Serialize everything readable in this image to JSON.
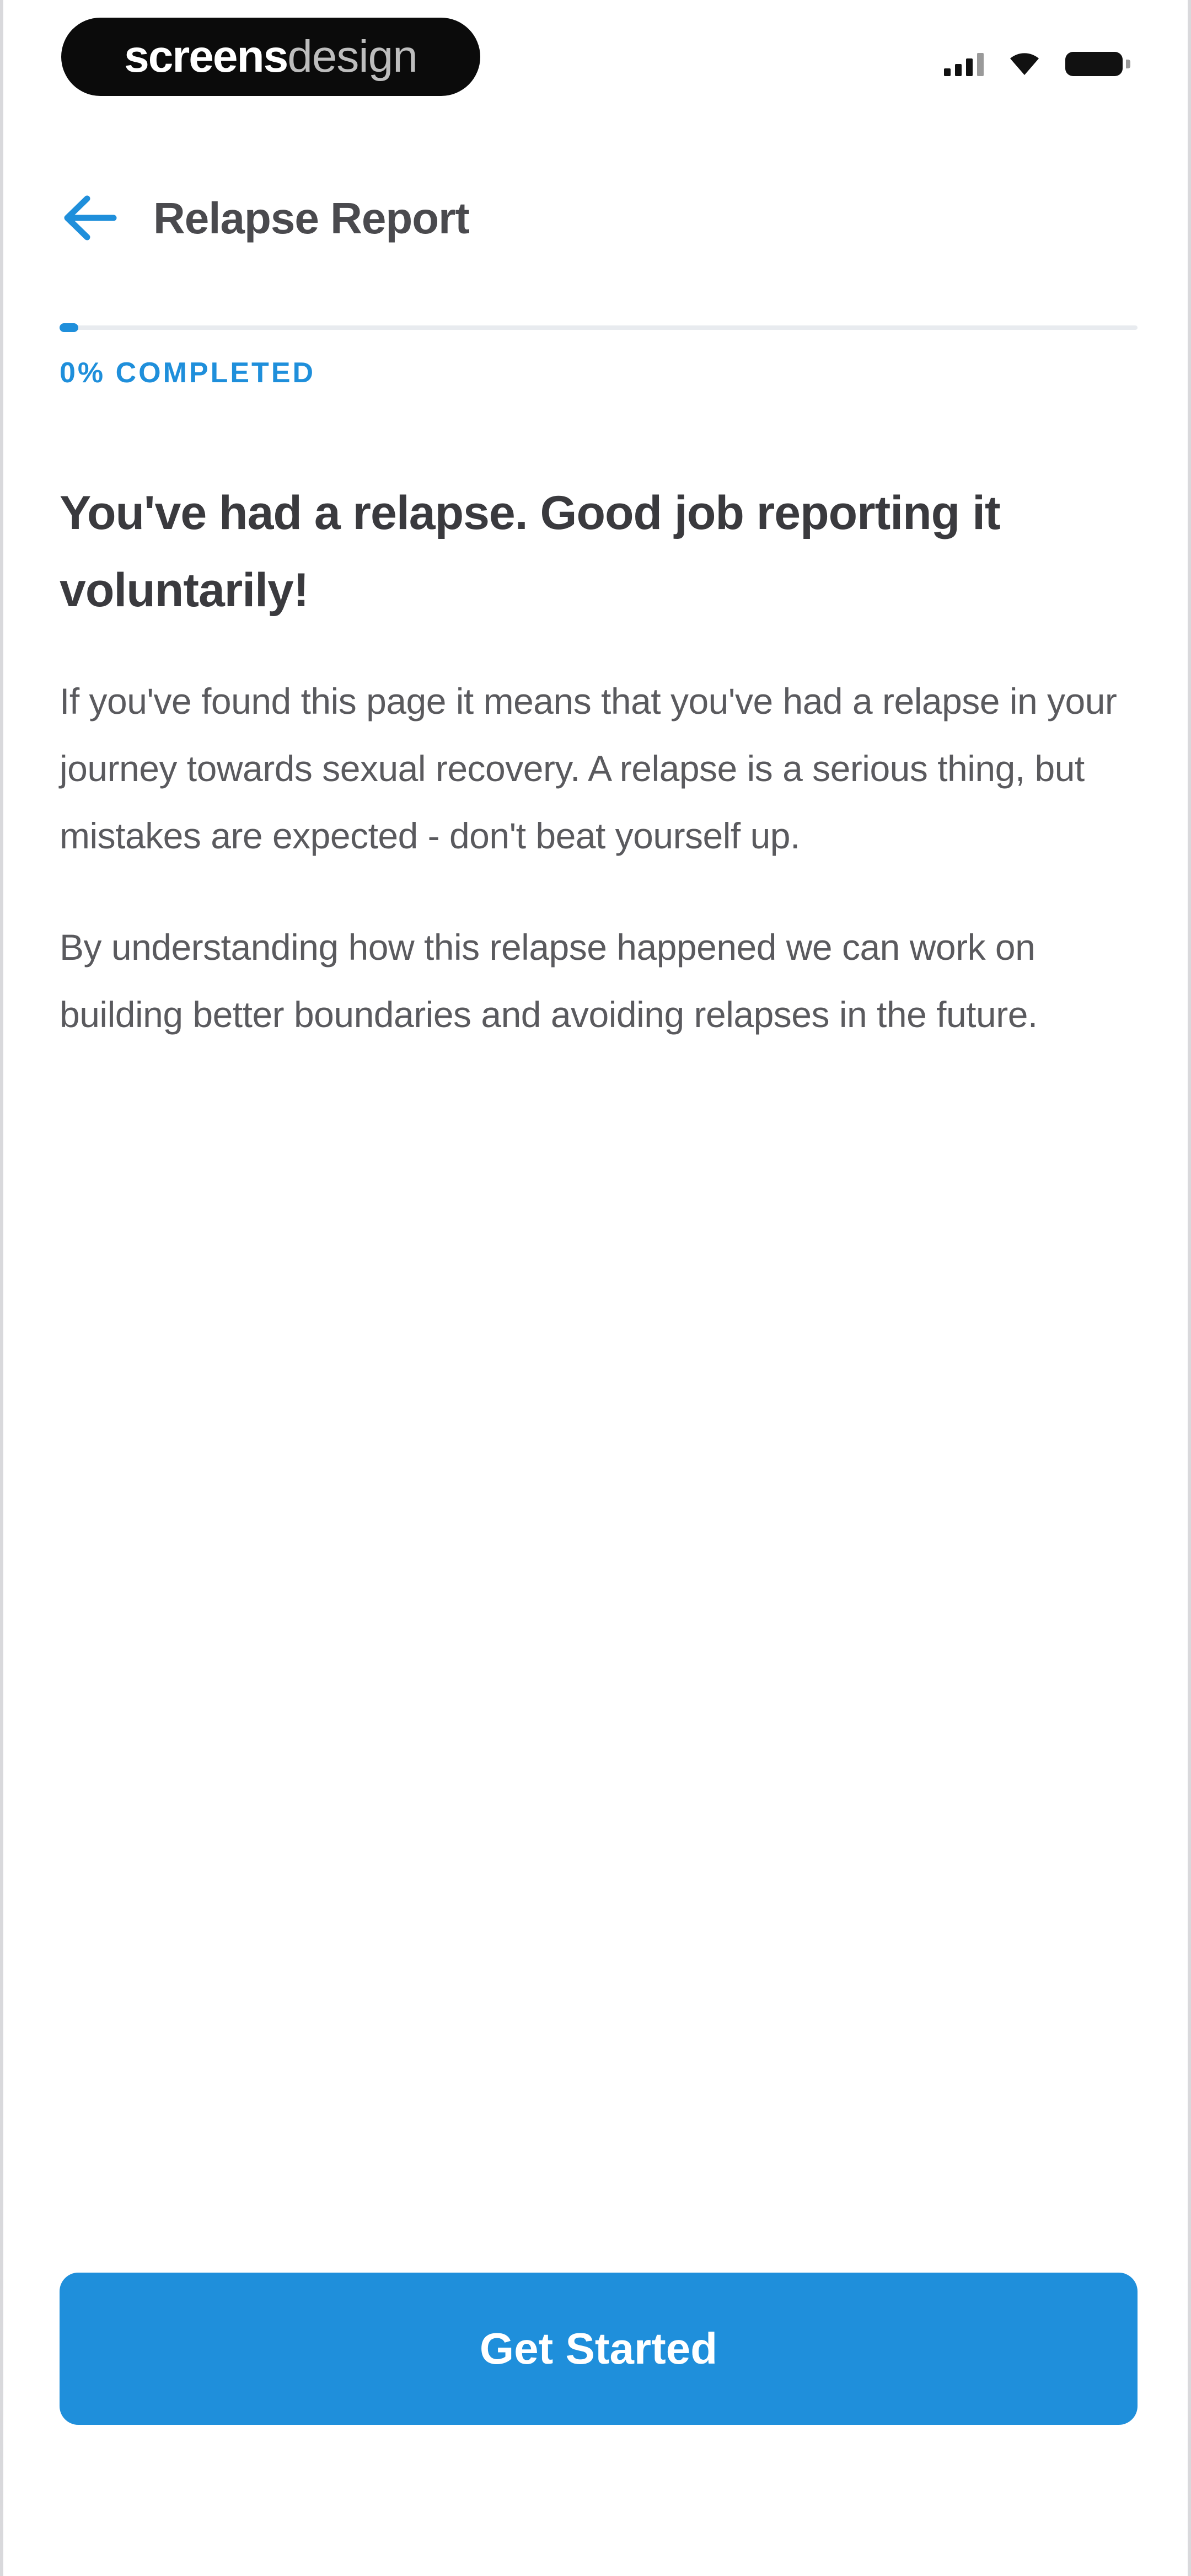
{
  "status_bar": {
    "brand_strong": "screens",
    "brand_light": "design",
    "icons": [
      "cellular-signal-icon",
      "wifi-icon",
      "battery-icon"
    ]
  },
  "header": {
    "back_icon": "arrow-left-icon",
    "title": "Relapse Report"
  },
  "progress": {
    "percent": 0,
    "label": "0% COMPLETED"
  },
  "content": {
    "headline": "You've had a relapse. Good job reporting it voluntarily!",
    "paragraphs": [
      "If you've found this page it means that you've had a relapse in your journey towards sexual recovery. A relapse is a serious thing, but mistakes are expected - don't beat yourself up.",
      "By understanding how this relapse happened we can work on building better boundaries and avoiding relapses in the future."
    ]
  },
  "cta": {
    "label": "Get Started"
  },
  "colors": {
    "accent": "#1f8fdb",
    "text_dark": "#3a3a3e",
    "text_body": "#5a5a5e"
  }
}
